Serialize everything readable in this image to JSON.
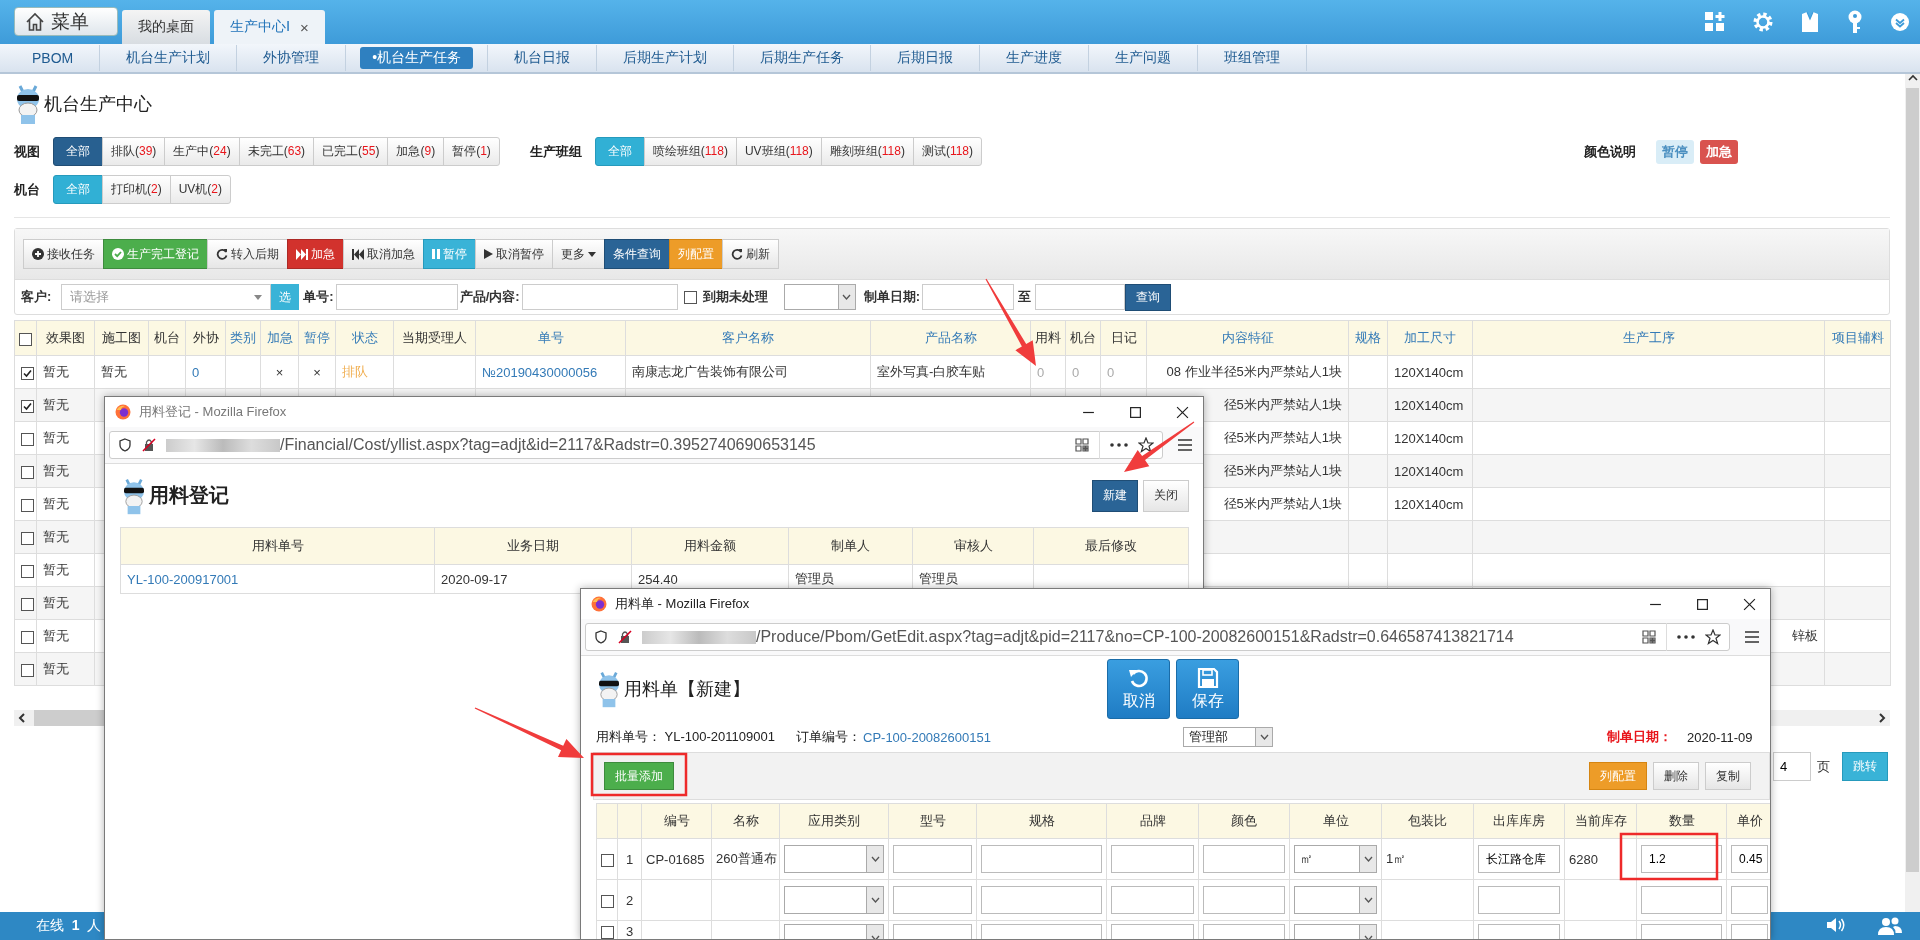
{
  "top_bar": {
    "menu_button": "菜单",
    "tabs": [
      {
        "label": "我的桌面",
        "selected": false
      },
      {
        "label": "生产中心Ⅰ",
        "selected": true,
        "close": "×"
      }
    ]
  },
  "nav": [
    {
      "label": "PBOM",
      "selected": false
    },
    {
      "label": "机台生产计划",
      "selected": false
    },
    {
      "label": "外协管理",
      "selected": false
    },
    {
      "label": "•机台生产任务",
      "selected": true
    },
    {
      "label": "机台日报",
      "selected": false
    },
    {
      "label": "后期生产计划",
      "selected": false
    },
    {
      "label": "后期生产任务",
      "selected": false
    },
    {
      "label": "后期日报",
      "selected": false
    },
    {
      "label": "生产进度",
      "selected": false
    },
    {
      "label": "生产问题",
      "selected": false
    },
    {
      "label": "班组管理",
      "selected": false
    }
  ],
  "page_title": "机台生产中心",
  "count_brackets": [
    "(",
    ")"
  ],
  "filter_rows": [
    [
      {
        "label": "视图",
        "kind": "primary",
        "options": [
          {
            "label": "全部",
            "selected": true
          },
          {
            "label": "排队",
            "count": "39",
            "selected": false
          },
          {
            "label": "生产中",
            "count": "24",
            "selected": false
          },
          {
            "label": "未完工",
            "count": "63",
            "selected": false
          },
          {
            "label": "已完工",
            "count": "55",
            "selected": false
          },
          {
            "label": "加急",
            "count": "9",
            "selected": false
          },
          {
            "label": "暂停",
            "count": "1",
            "selected": false
          }
        ]
      },
      {
        "label": "生产班组",
        "kind": "info",
        "options": [
          {
            "label": "全部",
            "selected": true
          },
          {
            "label": "喷绘班组",
            "count": "118",
            "selected": false
          },
          {
            "label": "UV班组",
            "count": "118",
            "selected": false
          },
          {
            "label": "雕刻班组",
            "count": "118",
            "selected": false
          },
          {
            "label": "测试",
            "count": "118",
            "selected": false
          }
        ]
      }
    ],
    [
      {
        "label": "机台",
        "kind": "info",
        "options": [
          {
            "label": "全部",
            "selected": true
          },
          {
            "label": "打印机",
            "count": "2",
            "selected": false
          },
          {
            "label": "UV机",
            "count": "2",
            "selected": false
          }
        ]
      }
    ]
  ],
  "legend": {
    "label": "颜色说明",
    "badges": [
      {
        "label": "暂停",
        "color": "#d9edf7"
      },
      {
        "label": "加急",
        "color": "#d9534f"
      }
    ]
  },
  "toolbar": [
    {
      "label": "接收任务",
      "kind": "default"
    },
    {
      "label": "生产完工登记",
      "kind": "success"
    },
    {
      "label": "转入后期",
      "kind": "default"
    },
    {
      "label": "加急",
      "kind": "danger"
    },
    {
      "label": "取消加急",
      "kind": "default"
    },
    {
      "label": "暂停",
      "kind": "info"
    },
    {
      "label": "取消暂停",
      "kind": "default"
    },
    {
      "label": "更多",
      "kind": "default"
    },
    {
      "label": "条件查询",
      "kind": "primary"
    },
    {
      "label": "列配置",
      "kind": "warning"
    },
    {
      "label": "刷新",
      "kind": "default"
    }
  ],
  "search": {
    "customer": {
      "label": "客户:",
      "placeholder": "请选择",
      "button": "选"
    },
    "order_no": {
      "label": "单号:"
    },
    "product": {
      "label": "产品/内容:"
    },
    "overdue": {
      "label": "到期未处理",
      "checked": false
    },
    "date_from": {
      "label": "制单日期:"
    },
    "date_to": {
      "label": "至"
    },
    "submit": "查询"
  },
  "table": {
    "all_checked": false,
    "columns": [
      {
        "label": "效果图",
        "sortable": false,
        "kind": "text"
      },
      {
        "label": "施工图",
        "sortable": false,
        "kind": "text"
      },
      {
        "label": "机台",
        "sortable": false,
        "kind": "text"
      },
      {
        "label": "外协",
        "sortable": false,
        "kind": "link"
      },
      {
        "label": "类别",
        "sortable": true,
        "kind": "text"
      },
      {
        "label": "加急",
        "sortable": true,
        "kind": "center"
      },
      {
        "label": "暂停",
        "sortable": true,
        "kind": "center"
      },
      {
        "label": "状态",
        "sortable": true,
        "kind": "status"
      },
      {
        "label": "当期受理人",
        "sortable": false,
        "kind": "text"
      },
      {
        "label": "单号",
        "sortable": true,
        "kind": "link"
      },
      {
        "label": "客户名称",
        "sortable": true,
        "kind": "text"
      },
      {
        "label": "产品名称",
        "sortable": true,
        "kind": "text"
      },
      {
        "label": "用料",
        "sortable": false,
        "kind": "muted"
      },
      {
        "label": "机台",
        "sortable": false,
        "kind": "muted"
      },
      {
        "label": "日记",
        "sortable": false,
        "kind": "muted"
      },
      {
        "label": "内容特征",
        "sortable": true,
        "kind": "end"
      },
      {
        "label": "规格",
        "sortable": true,
        "kind": "text"
      },
      {
        "label": "加工尺寸",
        "sortable": true,
        "kind": "text"
      },
      {
        "label": "生产工序",
        "sortable": true,
        "kind": "end"
      },
      {
        "label": "项目辅料",
        "sortable": true,
        "kind": "text"
      }
    ],
    "rows": [
      {
        "checked": true,
        "cells": [
          "暂无",
          "暂无",
          null,
          "0",
          null,
          "×",
          "×",
          "排队",
          null,
          "№20190430000056",
          "南康志龙广告装饰有限公司",
          "室外写真-白胶车贴",
          "0",
          "0",
          "0",
          "08 作业半径5米内严禁站人1块",
          null,
          "120X140cm",
          null,
          null
        ]
      },
      {
        "checked": true,
        "cells": [
          "暂无",
          null,
          null,
          null,
          null,
          null,
          null,
          null,
          null,
          null,
          null,
          null,
          null,
          null,
          null,
          "径5米内严禁站人1块",
          null,
          "120X140cm",
          null,
          null
        ]
      },
      {
        "checked": false,
        "cells": [
          "暂无",
          null,
          null,
          null,
          null,
          null,
          null,
          null,
          null,
          null,
          null,
          null,
          null,
          null,
          null,
          "径5米内严禁站人1块",
          null,
          "120X140cm",
          null,
          null
        ]
      },
      {
        "checked": false,
        "cells": [
          "暂无",
          null,
          null,
          null,
          null,
          null,
          null,
          null,
          null,
          null,
          null,
          null,
          null,
          null,
          null,
          "径5米内严禁站人1块",
          null,
          "120X140cm",
          null,
          null
        ]
      },
      {
        "checked": false,
        "cells": [
          "暂无",
          null,
          null,
          null,
          null,
          null,
          null,
          null,
          null,
          null,
          null,
          null,
          null,
          null,
          null,
          "径5米内严禁站人1块",
          null,
          "120X140cm",
          null,
          null
        ]
      },
      {
        "checked": false,
        "cells": [
          "暂无",
          null,
          null,
          null,
          null,
          null,
          null,
          null,
          null,
          null,
          null,
          null,
          null,
          null,
          null,
          null,
          null,
          null,
          null,
          null
        ]
      },
      {
        "checked": false,
        "cells": [
          "暂无",
          null,
          null,
          null,
          null,
          null,
          null,
          null,
          null,
          null,
          null,
          null,
          null,
          null,
          null,
          null,
          null,
          null,
          null,
          null
        ]
      },
      {
        "checked": false,
        "cells": [
          "暂无",
          null,
          null,
          null,
          null,
          null,
          null,
          null,
          null,
          null,
          null,
          null,
          null,
          null,
          null,
          null,
          null,
          null,
          null,
          null
        ]
      },
      {
        "checked": false,
        "cells": [
          "暂无",
          null,
          null,
          null,
          null,
          null,
          null,
          null,
          null,
          null,
          null,
          null,
          null,
          null,
          null,
          null,
          null,
          null,
          "锌板",
          null
        ]
      },
      {
        "checked": false,
        "cells": [
          "暂无",
          null,
          null,
          null,
          null,
          null,
          null,
          null,
          null,
          null,
          null,
          null,
          null,
          null,
          null,
          null,
          null,
          null,
          null,
          null
        ]
      }
    ]
  },
  "pager": {
    "page": "4",
    "unit": "页",
    "jump": "跳转"
  },
  "status_bar": {
    "online_label": "在线",
    "online_count": "1",
    "online_unit": "人"
  },
  "usage_window": {
    "title": "用料登记 - Mozilla Firefox",
    "url": "/Financial/Cost/yllist.aspx?tag=adjt&id=2117&Radstr=0.3952740690653145",
    "heading": "用料登记",
    "buttons": [
      {
        "label": "新建",
        "kind": "primary"
      },
      {
        "label": "关闭",
        "kind": "default"
      }
    ],
    "columns": [
      {
        "label": "用料单号",
        "kind": "link"
      },
      {
        "label": "业务日期",
        "kind": "text"
      },
      {
        "label": "用料金额",
        "kind": "text"
      },
      {
        "label": "制单人",
        "kind": "text"
      },
      {
        "label": "审核人",
        "kind": "text"
      },
      {
        "label": "最后修改",
        "kind": "text"
      }
    ],
    "rows": [
      {
        "cells": [
          "YL-100-200917001",
          "2020-09-17",
          "254.40",
          "管理员",
          "管理员",
          null
        ]
      }
    ]
  },
  "material_window": {
    "title": "用料单 - Mozilla Firefox",
    "url": "/Produce/Pbom/GetEdit.aspx?tag=adjt&pid=2117&no=CP-100-20082600151&Radstr=0.646587413821714",
    "heading": "用料单【新建】",
    "actions": [
      {
        "label": "取消"
      },
      {
        "label": "保存"
      }
    ],
    "info": {
      "doc_no_label": "用料单号：",
      "doc_no": "YL-100-201109001",
      "order_label": "订单编号：",
      "order_no": "CP-100-20082600151",
      "department": "管理部",
      "date_label": "制单日期：",
      "date": "2020-11-09"
    },
    "toolbar_left": [
      {
        "label": "批量添加",
        "kind": "success"
      }
    ],
    "toolbar_right": [
      {
        "label": "列配置",
        "kind": "warning"
      },
      {
        "label": "删除",
        "kind": "default"
      },
      {
        "label": "复制",
        "kind": "default"
      }
    ],
    "columns": [
      {
        "label": "编号",
        "kind": "text"
      },
      {
        "label": "名称",
        "kind": "text"
      },
      {
        "label": "应用类别",
        "kind": "select"
      },
      {
        "label": "型号",
        "kind": "input"
      },
      {
        "label": "规格",
        "kind": "input"
      },
      {
        "label": "品牌",
        "kind": "input"
      },
      {
        "label": "颜色",
        "kind": "input"
      },
      {
        "label": "单位",
        "kind": "select"
      },
      {
        "label": "包装比",
        "kind": "text"
      },
      {
        "label": "出库库房",
        "kind": "input"
      },
      {
        "label": "当前库存",
        "kind": "text"
      },
      {
        "label": "数量",
        "kind": "input"
      },
      {
        "label": "单价",
        "kind": "input"
      }
    ],
    "rows": [
      {
        "checked": false,
        "number": "1",
        "cells": [
          "CP-01685",
          "260普通布",
          null,
          null,
          null,
          null,
          null,
          "㎡",
          "1㎡",
          "长江路仓库",
          "6280",
          "1.2",
          "0.45"
        ]
      },
      {
        "checked": false,
        "number": "2",
        "cells": [
          null,
          null,
          null,
          null,
          null,
          null,
          null,
          null,
          null,
          null,
          null,
          null,
          null
        ]
      },
      {
        "checked": false,
        "number": "3",
        "cells": [
          null,
          null,
          null,
          null,
          null,
          null,
          null,
          null,
          null,
          null,
          null,
          null,
          null
        ]
      }
    ]
  }
}
